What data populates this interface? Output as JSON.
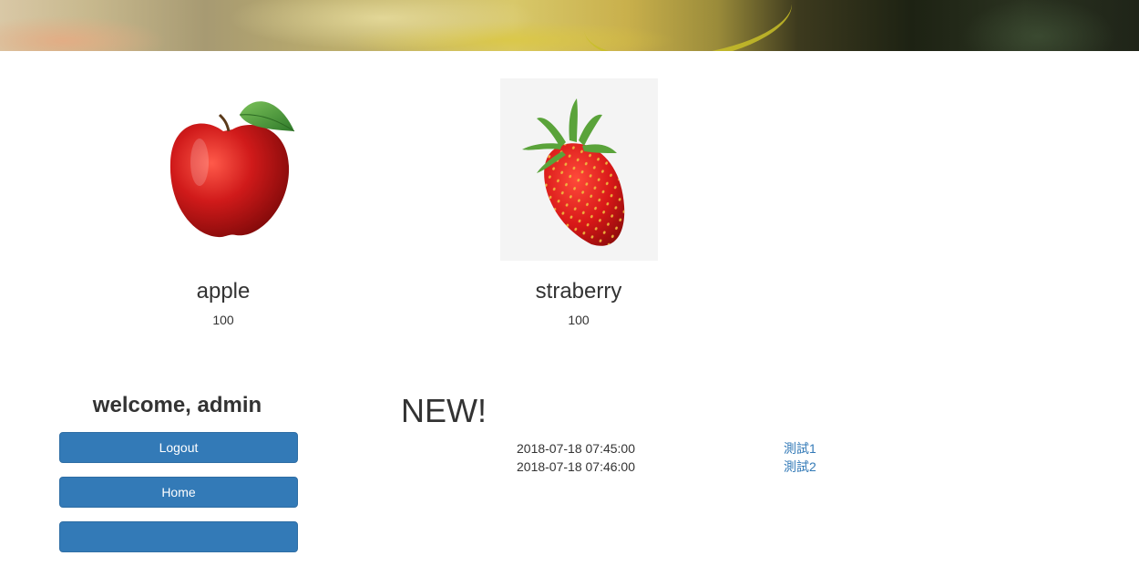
{
  "products": [
    {
      "name": "apple",
      "price": "100",
      "image": "apple"
    },
    {
      "name": "straberry",
      "price": "100",
      "image": "strawberry"
    }
  ],
  "sidebar": {
    "welcome": "welcome, admin",
    "buttons": [
      "Logout",
      "Home",
      ""
    ]
  },
  "news": {
    "title": "NEW!",
    "items": [
      {
        "date": "2018-07-18 07:45:00",
        "title": "測試1"
      },
      {
        "date": "2018-07-18 07:46:00",
        "title": "測試2"
      }
    ]
  },
  "colors": {
    "button_bg": "#337ab7",
    "link": "#337ab7",
    "text": "#333333"
  }
}
